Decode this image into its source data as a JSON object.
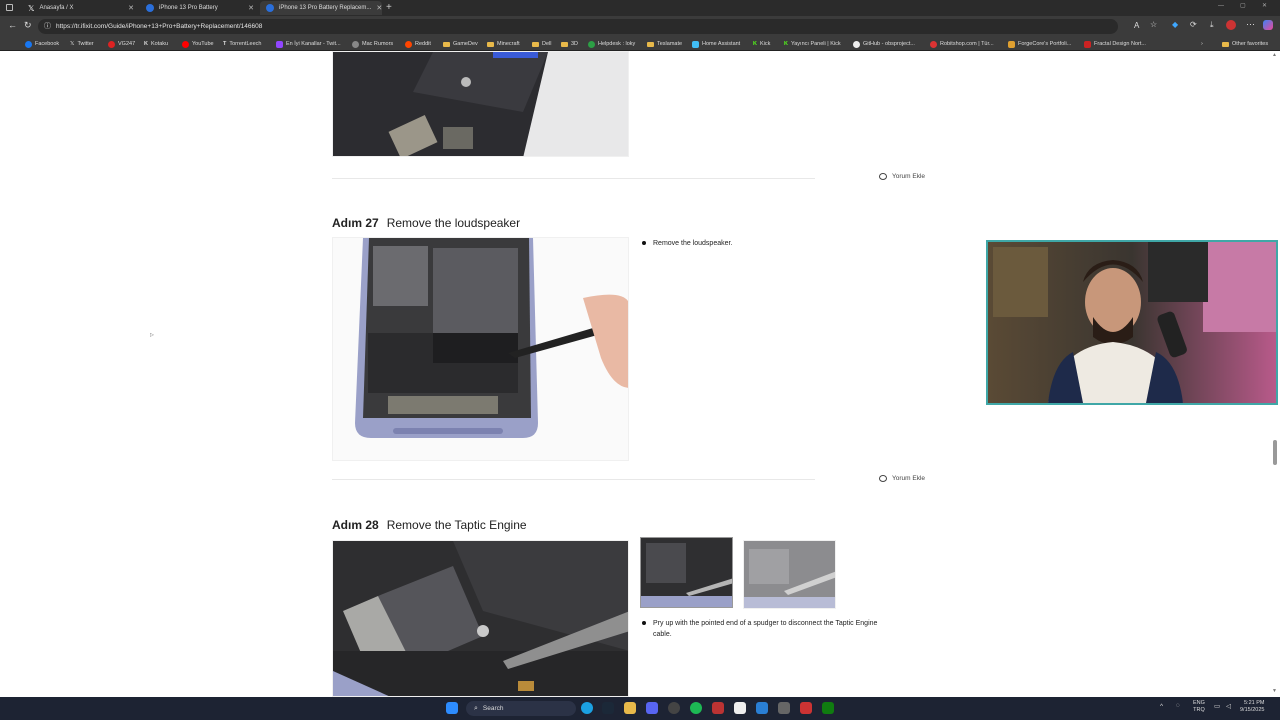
{
  "browser": {
    "tabs": [
      {
        "label": "Anasayfa / X",
        "active": false
      },
      {
        "label": "iPhone 13 Pro Battery",
        "active": false
      },
      {
        "label": "iPhone 13 Pro Battery Replacem...",
        "active": true
      }
    ],
    "url": "https://tr.ifixit.com/Guide/iPhone+13+Pro+Battery+Replacement/146608",
    "bookmarks": [
      "Facebook",
      "Twitter",
      "VG247",
      "Kotaku",
      "YouTube",
      "TorrentLeech",
      "En İyi Kanallar - Twit...",
      "Mac Rumors",
      "Reddit",
      "GameDev",
      "Minecraft",
      "Dell",
      "3D",
      "Helpdesk : loky",
      "Teslamate",
      "Home Assistant",
      "Kick",
      "Yayıncı Paneli | Kick",
      "GitHub - obsproject...",
      "Robitshop.com | Tür...",
      "ForgeCore's Portfoli...",
      "Fractal Design Nort..."
    ],
    "other_favorites": "Other favorites"
  },
  "guide": {
    "comment_label": "Yorum Ekle",
    "step27": {
      "prefix": "Adım 27",
      "title": "Remove the loudspeaker",
      "bullets": [
        "Remove the loudspeaker."
      ]
    },
    "step28": {
      "prefix": "Adım 28",
      "title": "Remove the Taptic Engine",
      "bullets": [
        "Pry up with the pointed end of a spudger to disconnect the Taptic Engine cable."
      ]
    }
  },
  "taskbar": {
    "search_label": "Search",
    "lang_top": "ENG",
    "lang_bottom": "TRQ",
    "time": "5:21 PM",
    "date": "9/15/2025"
  },
  "colors": {
    "accent": "#3fa7a7",
    "taskbar": "#1d2333",
    "chrome": "#3b3b3b"
  }
}
